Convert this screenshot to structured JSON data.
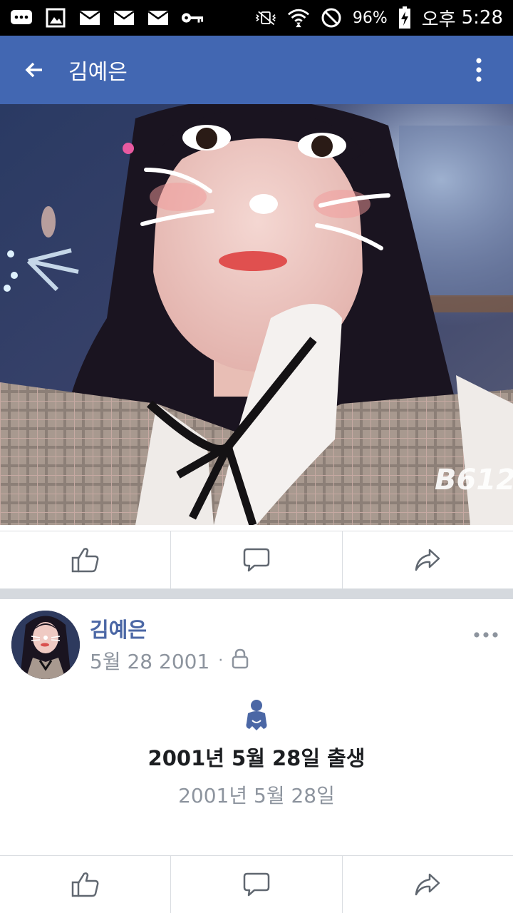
{
  "status_bar": {
    "battery_percent": "96%",
    "ampm": "오후",
    "time": "5:28",
    "left_icons": [
      "chat-icon",
      "image-icon",
      "mail-icon",
      "mail-icon",
      "mail-icon",
      "key-icon"
    ],
    "right_icons": [
      "vibrate-icon",
      "wifi-icon",
      "block-icon",
      "battery-charging-icon"
    ]
  },
  "app_bar": {
    "title": "김예은",
    "color": "#4267b2"
  },
  "photo": {
    "watermark": "B612"
  },
  "post": {
    "author": "김예은",
    "date": "5월 28 2001",
    "separator": "·",
    "privacy_icon": "lock-icon",
    "event_icon": "baby-icon",
    "event_title": "2001년 5월 28일 출생",
    "event_date": "2001년 5월 28일"
  },
  "actions": [
    {
      "icon": "like-icon"
    },
    {
      "icon": "comment-icon"
    },
    {
      "icon": "share-icon"
    }
  ]
}
